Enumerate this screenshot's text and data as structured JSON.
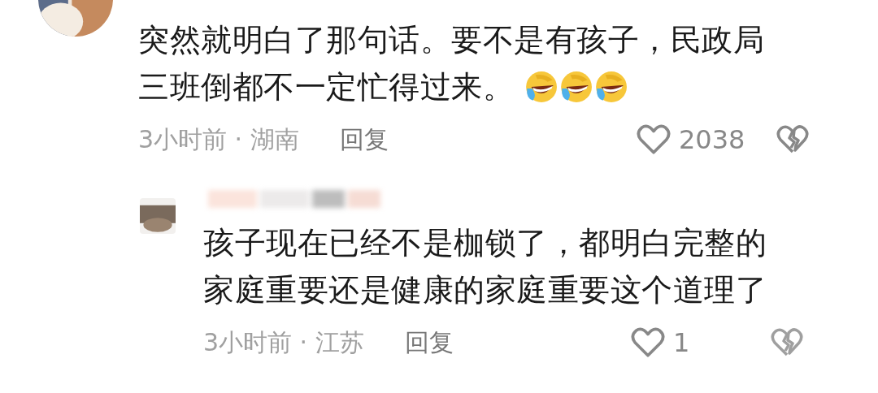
{
  "comments": [
    {
      "kind": "comment",
      "lines": [
        "突然就明白了那句话。要不是有孩子，民政局",
        "三班倒都不一定忙得过来。"
      ],
      "emojis": [
        {
          "kind": "laugh-cry"
        },
        {
          "kind": "laugh-cry"
        },
        {
          "kind": "laugh-cry"
        }
      ],
      "meta": "3小时前 · 湖南",
      "reply_label": "回复",
      "likes": "2038"
    },
    {
      "kind": "reply",
      "lines": [
        "孩子现在已经不是枷锁了，都明白完整的",
        "家庭重要还是健康的家庭重要这个道理了"
      ],
      "meta": "3小时前 · 江苏",
      "reply_label": "回复",
      "likes": "1"
    }
  ]
}
